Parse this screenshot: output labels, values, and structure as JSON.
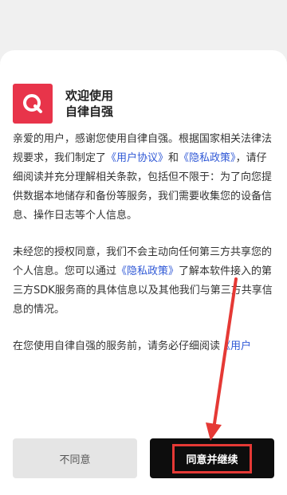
{
  "app": {
    "name_line1": "欢迎使用",
    "name_line2": "自律自强",
    "logo_icon": "q-logo-icon",
    "logo_color": "#e8344a"
  },
  "content": {
    "p1_a": "亲爱的用户，感谢您使用自律自强。根据国家相关法律法规要求，我们制定了",
    "p1_link1": "《用户协议》",
    "p1_b": "和",
    "p1_link2": "《隐私政策》",
    "p1_c": "，请仔细阅读并充分理解相关条款，包括但不限于：为了向您提供数据本地储存和备份等服务，我们需要收集您的设备信息、操作日志等个人信息。",
    "p2_a": "未经您的授权同意，我们不会主动向任何第三方共享您的个人信息。您可以通过",
    "p2_link": "《隐私政策》",
    "p2_b": "了解本软件接入的第三方SDK服务商的具体信息以及其他我们与第三方共享信息的情况。",
    "p3_a": "在您使用自律自强的服务前，请务必仔细阅读",
    "p3_link": "《用户"
  },
  "buttons": {
    "disagree": "不同意",
    "agree": "同意并继续"
  },
  "colors": {
    "link": "#2f58d6",
    "annotation": "#e53935"
  }
}
